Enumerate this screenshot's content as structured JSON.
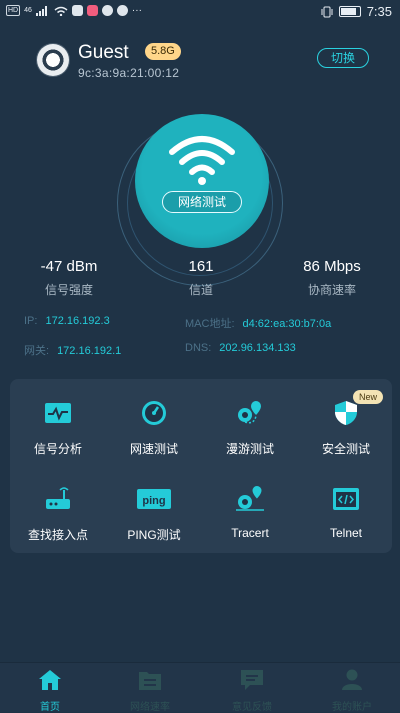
{
  "status_bar": {
    "left_chips": [
      "HD",
      "46"
    ],
    "time": "7:35"
  },
  "network": {
    "ssid": "Guest",
    "band": "5.8G",
    "bssid": "9c:3a:9a:21:00:12",
    "switch_label": "切换"
  },
  "speed_test": {
    "button_label": "网络测试"
  },
  "stats": [
    {
      "value": "-47 dBm",
      "label": "信号强度"
    },
    {
      "value": "161",
      "label": "信道"
    },
    {
      "value": "86 Mbps",
      "label": "协商速率"
    }
  ],
  "details": {
    "ip_label": "IP:",
    "ip_value": "172.16.192.3",
    "mac_label": "MAC地址:",
    "mac_value": "d4:62:ea:30:b7:0a",
    "gateway_label": "网关:",
    "gateway_value": "172.16.192.1",
    "dns_label": "DNS:",
    "dns_value": "202.96.134.133"
  },
  "tools": [
    {
      "label": "信号分析",
      "icon": "signal-wave-icon"
    },
    {
      "label": "网速测试",
      "icon": "speedometer-icon"
    },
    {
      "label": "漫游测试",
      "icon": "route-pin-icon"
    },
    {
      "label": "安全测试",
      "icon": "shield-icon",
      "badge": "New"
    },
    {
      "label": "查找接入点",
      "icon": "router-icon"
    },
    {
      "label": "PING测试",
      "icon": "ping-icon"
    },
    {
      "label": "Tracert",
      "icon": "tracert-icon"
    },
    {
      "label": "Telnet",
      "icon": "code-icon"
    }
  ],
  "tabs": [
    {
      "label": "首页",
      "active": true
    },
    {
      "label": "网络速率",
      "active": false
    },
    {
      "label": "意见反馈",
      "active": false
    },
    {
      "label": "我的账户",
      "active": false
    }
  ],
  "colors": {
    "background": "#1f3346",
    "accent": "#24cbd8",
    "card": "#2a3e52",
    "badge": "#ffd68a"
  }
}
